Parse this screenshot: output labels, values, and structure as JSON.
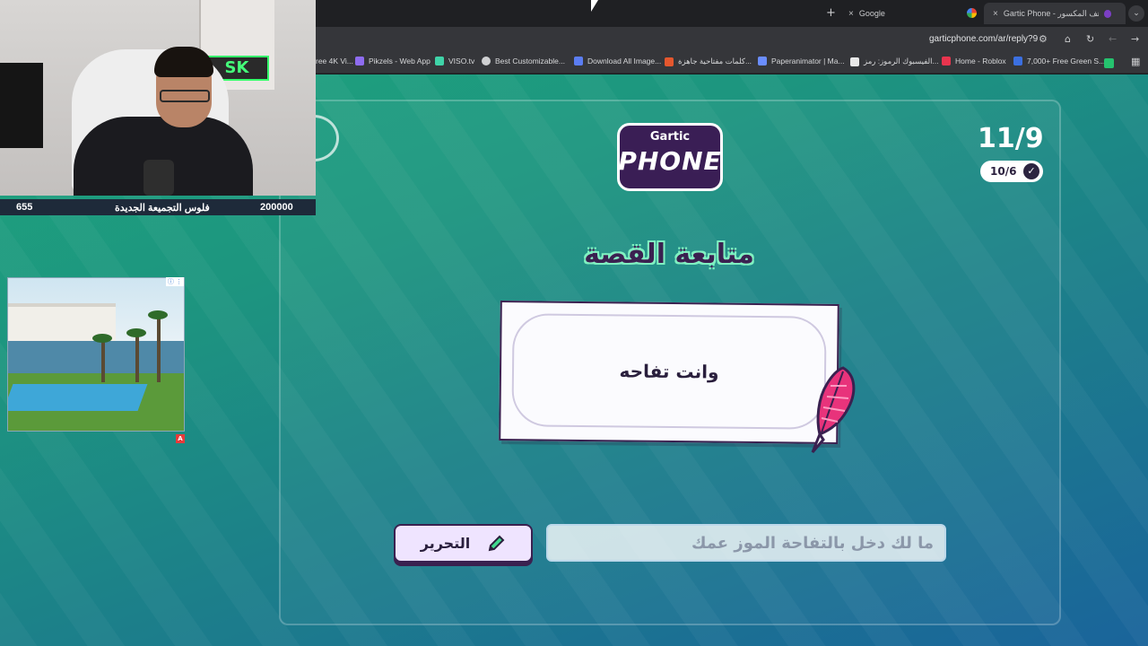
{
  "browser": {
    "tabs": [
      {
        "title": "Google",
        "close": "×"
      },
      {
        "title": "Gartic Phone - الهاتف المكسور",
        "close": "×"
      }
    ],
    "new_tab": "+",
    "url": "garticphone.com/ar/reply?9",
    "bookmarks": [
      "ree 4K Vi...",
      "Pikzels - Web App",
      "VISO.tv",
      "Best Customizable...",
      "Download All Image...",
      "كلمات مفتاحية جاهزة...",
      "Paperanimator | Ma...",
      "الفيسبوك الرموز: رمز...",
      "Home - Roblox",
      "7,000+ Free Green S..."
    ],
    "colors": {
      "tab_bg": "#1f2023",
      "toolbar_bg": "#35363a",
      "page_top": "#1ea47e",
      "page_bottom": "#1a649b",
      "accent_dark": "#3a2150"
    }
  },
  "game": {
    "logo_top": "Gartic",
    "logo_bottom": "PHONE",
    "round": "11/9",
    "done_count": "10/6",
    "heading": "متابعة القصة",
    "prompt": "وانت تفاحه",
    "edit_label": "التحرير",
    "answer_value": "ما لك دخل بالتفاحة الموز عمك"
  },
  "stream": {
    "left_value": "655",
    "label": "فلوس التجميعة الجديدة",
    "right_value": "200000",
    "neon_sign": "SK"
  },
  "ad": {
    "info": "ⓘ ⋮",
    "badge": "A"
  }
}
